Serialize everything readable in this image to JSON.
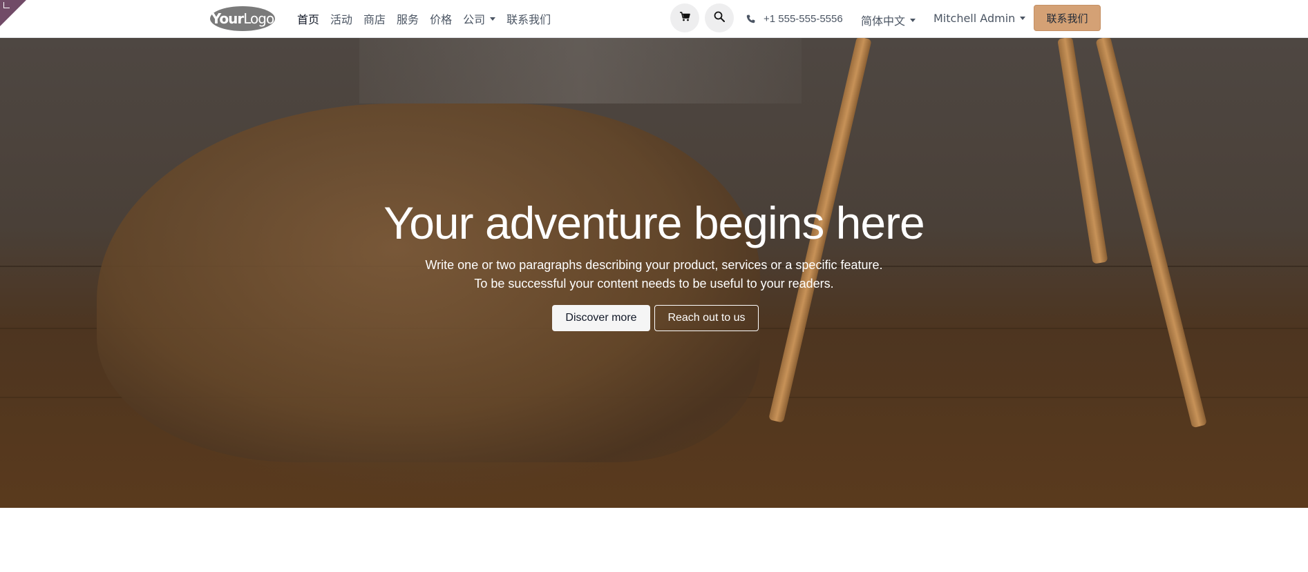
{
  "header": {
    "logo": {
      "bold": "Your",
      "light": "Logo"
    },
    "nav": [
      {
        "label": "首页",
        "active": true
      },
      {
        "label": "活动"
      },
      {
        "label": "商店"
      },
      {
        "label": "服务"
      },
      {
        "label": "价格"
      },
      {
        "label": "公司",
        "dropdown": true
      },
      {
        "label": "联系我们"
      }
    ],
    "icons": {
      "cart": "shopping-cart-icon",
      "search": "search-icon",
      "phone": "phone-icon"
    },
    "phone": "+1 555-555-5556",
    "language": "简体中文",
    "user": "Mitchell Admin",
    "cta": "联系我们",
    "colors": {
      "cta_bg": "#d4a175",
      "edit_corner": "#714b67"
    }
  },
  "hero": {
    "title": "Your adventure begins here",
    "line1": "Write one or two paragraphs describing your product, services or a specific feature.",
    "line2": "To be successful your content needs to be useful to your readers.",
    "primary_button": "Discover more",
    "secondary_button": "Reach out to us"
  }
}
